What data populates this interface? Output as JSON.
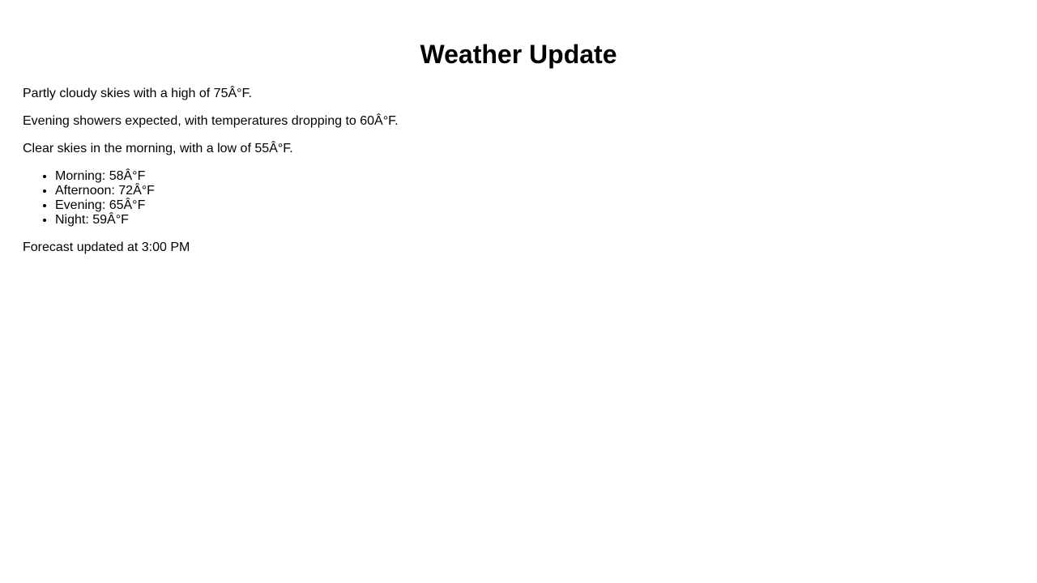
{
  "page_title": "Weather Update",
  "paragraphs": [
    "Partly cloudy skies with a high of 75Â°F.",
    "Evening showers expected, with temperatures dropping to 60Â°F.",
    "Clear skies in the morning, with a low of 55Â°F."
  ],
  "forecast_list": [
    "Morning: 58Â°F",
    "Afternoon: 72Â°F",
    "Evening: 65Â°F",
    "Night: 59Â°F"
  ],
  "footer_note": "Forecast updated at 3:00 PM"
}
